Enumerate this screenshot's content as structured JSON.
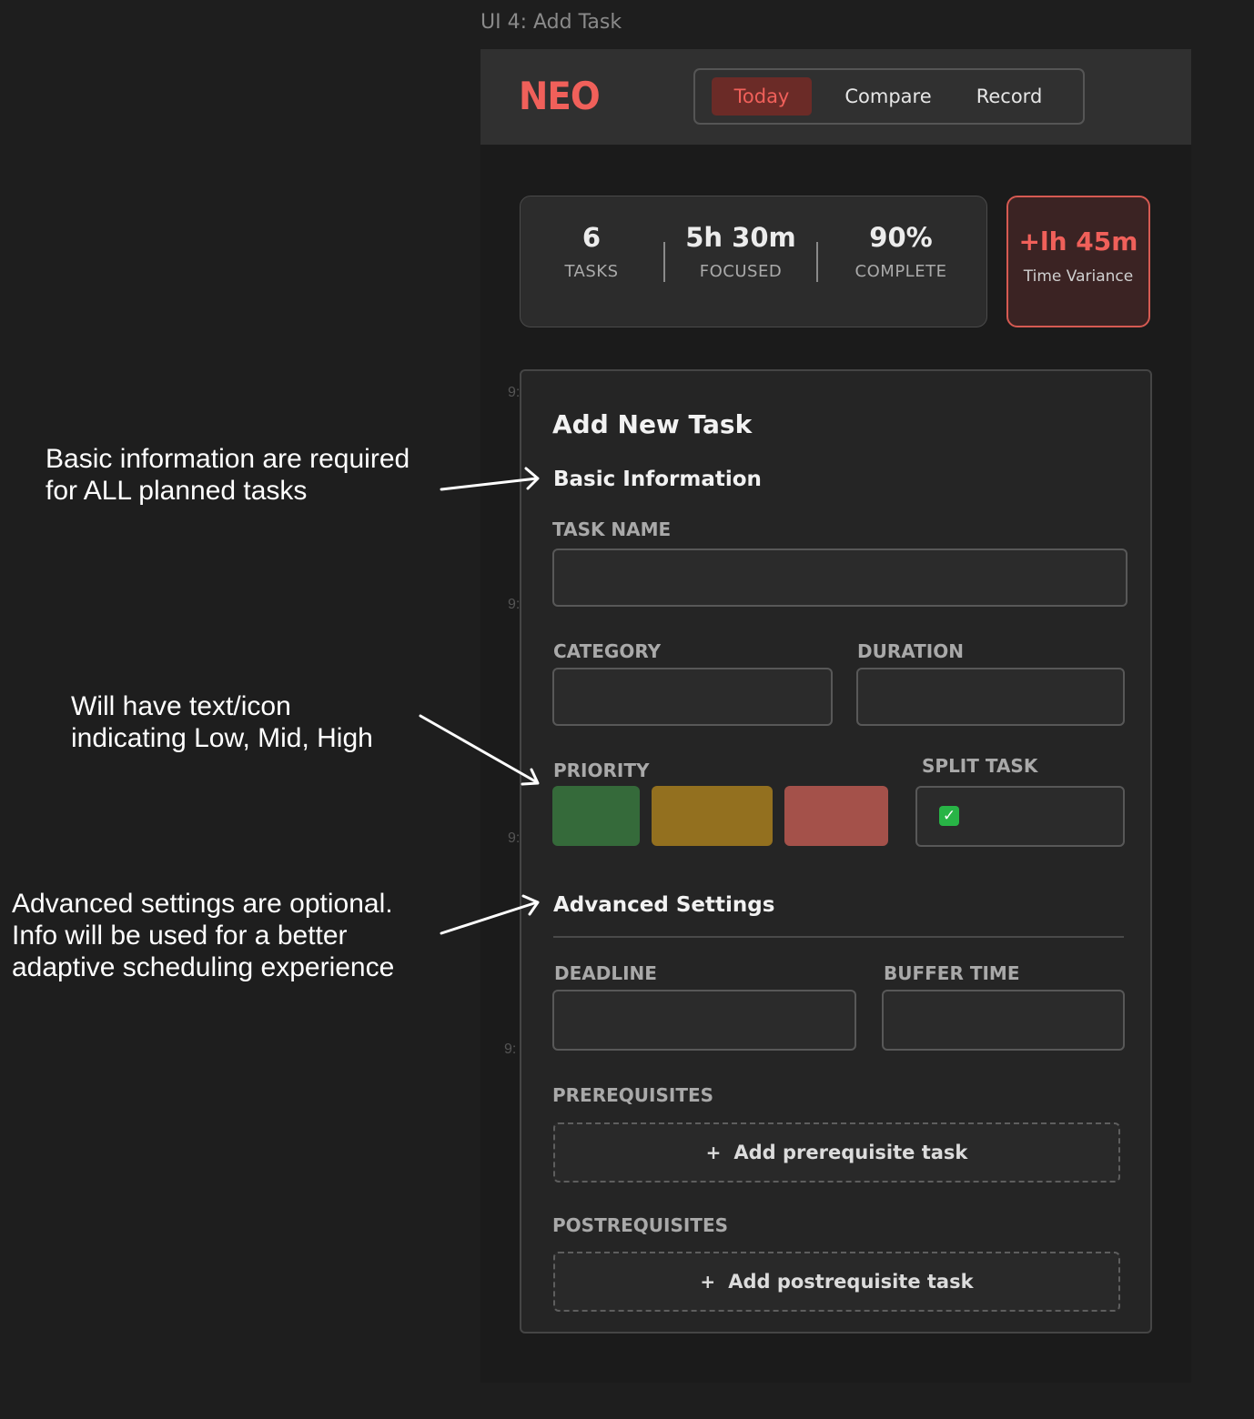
{
  "frame_label": "UI 4: Add Task",
  "annotations": {
    "basic_info": [
      "Basic information are required",
      "for ALL planned tasks"
    ],
    "priority": [
      "Will have text/icon",
      "indicating Low, Mid, High"
    ],
    "advanced": [
      "Advanced settings are optional.",
      "Info will be used for a better",
      "adaptive scheduling experience"
    ]
  },
  "app": {
    "logo": "NEO",
    "tabs": [
      {
        "label": "Today",
        "active": true
      },
      {
        "label": "Compare",
        "active": false
      },
      {
        "label": "Record",
        "active": false
      }
    ],
    "stats": [
      {
        "value": "6",
        "label": "TASKS"
      },
      {
        "value": "5h 30m",
        "label": "FOCUSED"
      },
      {
        "value": "90%",
        "label": "COMPLETE"
      }
    ],
    "variance": {
      "value": "+lh 45m",
      "label": "Time Variance"
    },
    "timeline_fragments": [
      "9:",
      "9:",
      "9:",
      "9:"
    ],
    "form": {
      "title": "Add New Task",
      "basic_section": "Basic Information",
      "task_name_label": "TASK NAME",
      "task_name_value": "",
      "category_label": "CATEGORY",
      "category_value": "",
      "duration_label": "DURATION",
      "duration_value": "",
      "priority_label": "PRIORITY",
      "priority_colors": {
        "low": "#356a3a",
        "mid": "#93701f",
        "high": "#a4514a"
      },
      "split_task_label": "SPLIT TASK",
      "split_task_checked": true,
      "advanced_section": "Advanced Settings",
      "deadline_label": "DEADLINE",
      "deadline_value": "",
      "buffer_label": "BUFFER TIME",
      "buffer_value": "",
      "prerequisites_label": "PREREQUISITES",
      "add_prerequisite": "Add prerequisite task",
      "postrequisites_label": "POSTREQUISITES",
      "add_postrequisite": "Add postrequisite task",
      "plus_glyph": "+"
    }
  },
  "colors": {
    "accent": "#f0605a",
    "active_tab_bg": "#6b2b27",
    "variance_bg": "#3b2323",
    "check_green": "#28b446"
  }
}
